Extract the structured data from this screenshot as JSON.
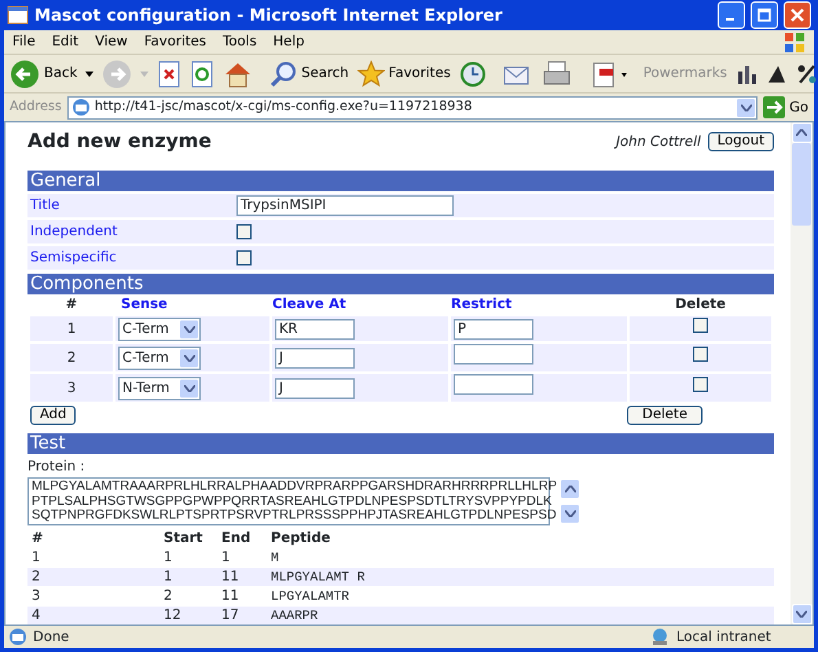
{
  "window": {
    "title": "Mascot configuration - Microsoft Internet Explorer"
  },
  "menu": [
    "File",
    "Edit",
    "View",
    "Favorites",
    "Tools",
    "Help"
  ],
  "toolbar": {
    "back": "Back",
    "search": "Search",
    "favorites": "Favorites",
    "powermarks": "Powermarks"
  },
  "address": {
    "label": "Address",
    "url": "http://t41-jsc/mascot/x-cgi/ms-config.exe?u=1197218938",
    "go": "Go"
  },
  "page": {
    "heading": "Add new enzyme",
    "user": "John Cottrell",
    "logout": "Logout"
  },
  "general": {
    "title": "General",
    "fields": [
      {
        "label": "Title",
        "kind": "text",
        "value": "TrypsinMSIPI"
      },
      {
        "label": "Independent",
        "kind": "checkbox",
        "checked": false
      },
      {
        "label": "Semispecific",
        "kind": "checkbox",
        "checked": false
      }
    ]
  },
  "components": {
    "title": "Components",
    "columns": [
      "#",
      "Sense",
      "Cleave At",
      "Restrict",
      "Delete"
    ],
    "rows": [
      {
        "number": "1",
        "sense": "C-Term",
        "cleave_at": "KR",
        "restrict": "P",
        "delete": false
      },
      {
        "number": "2",
        "sense": "C-Term",
        "cleave_at": "J",
        "restrict": "",
        "delete": false
      },
      {
        "number": "3",
        "sense": "N-Term",
        "cleave_at": "J",
        "restrict": "",
        "delete": false
      }
    ],
    "add_button": "Add",
    "delete_button": "Delete"
  },
  "test": {
    "title": "Test",
    "protein_label": "Protein :",
    "protein_lines": [
      "MLPGYALAMTRAAARPRLHLRRALPHAADDVRPRARPPGARSHDRARHRRRPRLLHLRP",
      "PTPLSALPHSGTWSGPPGPWPPQRRTASREAHLGTPDLNPESPSDTLTRYSVPPYPDLK",
      "SQTPNPRGFDKSWLRLPTSPRTPSRVPTRLPRSSSPPHPJTASREAHLGTPDLNPESPSD"
    ],
    "columns": [
      "#",
      "Start",
      "End",
      "Peptide"
    ],
    "rows": [
      {
        "number": "1",
        "start": "1",
        "end": "1",
        "peptide": "M"
      },
      {
        "number": "2",
        "start": "1",
        "end": "11",
        "peptide": "MLPGYALAMT R"
      },
      {
        "number": "3",
        "start": "2",
        "end": "11",
        "peptide": "LPGYALAMTR"
      },
      {
        "number": "4",
        "start": "12",
        "end": "17",
        "peptide": "AAARPR"
      }
    ]
  },
  "status_bar": {
    "text": "Done",
    "zone": "Local intranet"
  }
}
